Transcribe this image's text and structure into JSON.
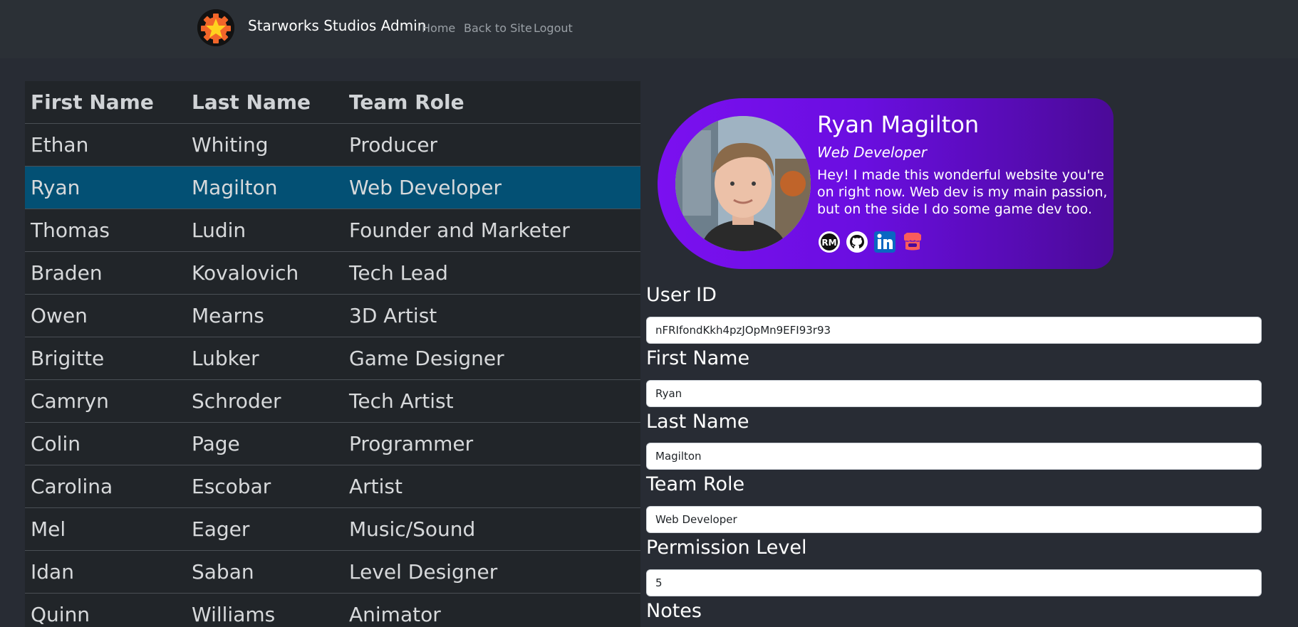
{
  "nav": {
    "brand": "Starworks Studios Admin",
    "links": [
      "Home",
      "Back to Site",
      "Logout"
    ]
  },
  "table": {
    "headers": [
      "First Name",
      "Last Name",
      "Team Role"
    ],
    "rows": [
      [
        "Ethan",
        "Whiting",
        "Producer"
      ],
      [
        "Ryan",
        "Magilton",
        "Web Developer"
      ],
      [
        "Thomas",
        "Ludin",
        "Founder and Marketer"
      ],
      [
        "Braden",
        "Kovalovich",
        "Tech Lead"
      ],
      [
        "Owen",
        "Mearns",
        "3D Artist"
      ],
      [
        "Brigitte",
        "Lubker",
        "Game Designer"
      ],
      [
        "Camryn",
        "Schroder",
        "Tech Artist"
      ],
      [
        "Colin",
        "Page",
        "Programmer"
      ],
      [
        "Carolina",
        "Escobar",
        "Artist"
      ],
      [
        "Mel",
        "Eager",
        "Music/Sound"
      ],
      [
        "Idan",
        "Saban",
        "Level Designer"
      ],
      [
        "Quinn",
        "Williams",
        "Animator"
      ]
    ],
    "selected_row": 1,
    "selected_color": "#035074"
  },
  "card": {
    "name": "Ryan Magilton",
    "role": "Web Developer",
    "bio": "Hey! I made this wonderful website you're on right now. Web dev is my main passion, but on the side I do some game dev too.",
    "social_icons": [
      "rm-logo-icon",
      "github-icon",
      "linkedin-icon",
      "itchio-icon"
    ],
    "gradient": [
      "#7b10f0",
      "#4b0a98"
    ]
  },
  "form": {
    "fields": [
      {
        "label": "User ID",
        "value": "nFRIfondKkh4pzJOpMn9EFI93r93"
      },
      {
        "label": "First Name",
        "value": "Ryan"
      },
      {
        "label": "Last Name",
        "value": "Magilton"
      },
      {
        "label": "Team Role",
        "value": "Web Developer"
      },
      {
        "label": "Permission Level",
        "value": "5"
      }
    ],
    "notes_label": "Notes"
  }
}
